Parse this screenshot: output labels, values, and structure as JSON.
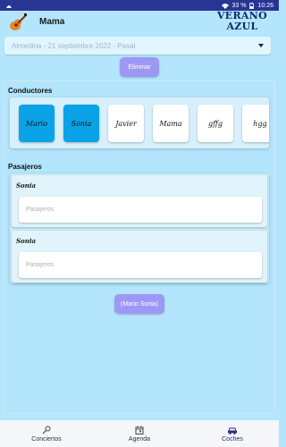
{
  "status_bar": {
    "left_icon": "android-notification-icon",
    "battery": "33 %",
    "time": "10:26"
  },
  "app": {
    "title": "Mama",
    "logo_line1": "VERANO",
    "logo_line2": "AZUL",
    "icon": "guitar-icon"
  },
  "concert_select": {
    "value": "Almedina - 21 septiembre 2022 - Pasal"
  },
  "eliminar_label": "Eliminar",
  "conductores": {
    "label": "Conductores",
    "chips": [
      {
        "name": "Mario",
        "selected": true
      },
      {
        "name": "Sonia",
        "selected": true
      },
      {
        "name": "Javier",
        "selected": false
      },
      {
        "name": "Mama",
        "selected": false
      },
      {
        "name": "gffg",
        "selected": false
      },
      {
        "name": "hgg",
        "selected": false
      }
    ]
  },
  "pasajeros": {
    "label": "Pasajeros",
    "cards": [
      {
        "driver": "Sonia",
        "placeholder": "Pasajeros"
      },
      {
        "driver": "Sonia",
        "placeholder": "Pasajeros"
      }
    ]
  },
  "summary_button": "(Mario Sonia)",
  "bottom_nav": {
    "items": [
      {
        "label": "Conciertos",
        "icon": "microphone-icon"
      },
      {
        "label": "Agenda",
        "icon": "calendar-icon"
      },
      {
        "label": "Coches",
        "icon": "car-icon",
        "active": true
      }
    ]
  },
  "colors": {
    "background": "#b3e5fc",
    "accent_button": "#9e98f5",
    "selected_chip": "#0aa3e8",
    "status_bar": "#283593"
  }
}
